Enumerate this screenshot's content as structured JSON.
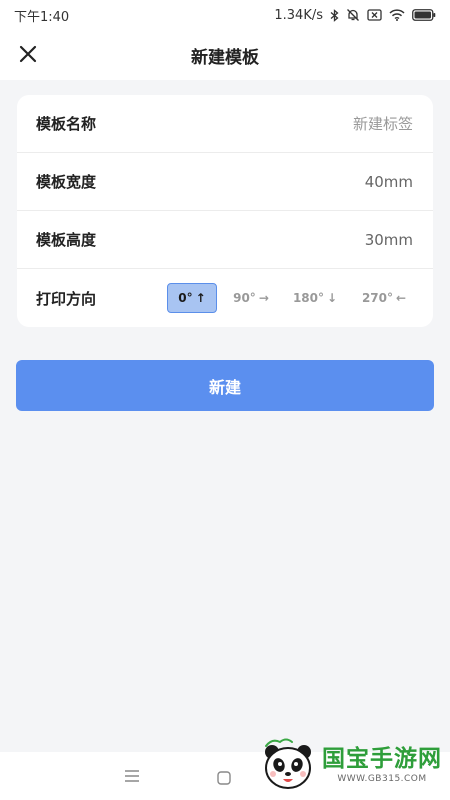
{
  "status_bar": {
    "time": "下午1:40",
    "net_speed": "1.34K/s"
  },
  "nav": {
    "title": "新建模板"
  },
  "form": {
    "name": {
      "label": "模板名称",
      "placeholder": "新建标签",
      "value": ""
    },
    "width": {
      "label": "模板宽度",
      "value": "40mm"
    },
    "height": {
      "label": "模板高度",
      "value": "30mm"
    },
    "orientation": {
      "label": "打印方向",
      "options": [
        {
          "label": "0°",
          "arrow": "↑",
          "selected": true
        },
        {
          "label": "90°",
          "arrow": "→",
          "selected": false
        },
        {
          "label": "180°",
          "arrow": "↓",
          "selected": false
        },
        {
          "label": "270°",
          "arrow": "←",
          "selected": false
        }
      ]
    }
  },
  "actions": {
    "create_label": "新建"
  },
  "watermark": {
    "text": "国宝手游网",
    "url": "WWW.GB315.COM"
  },
  "colors": {
    "accent": "#5b8fef",
    "selected_bg": "#a8c4f2",
    "selected_border": "#5b8fea",
    "watermark_green": "#2e9e3a"
  }
}
